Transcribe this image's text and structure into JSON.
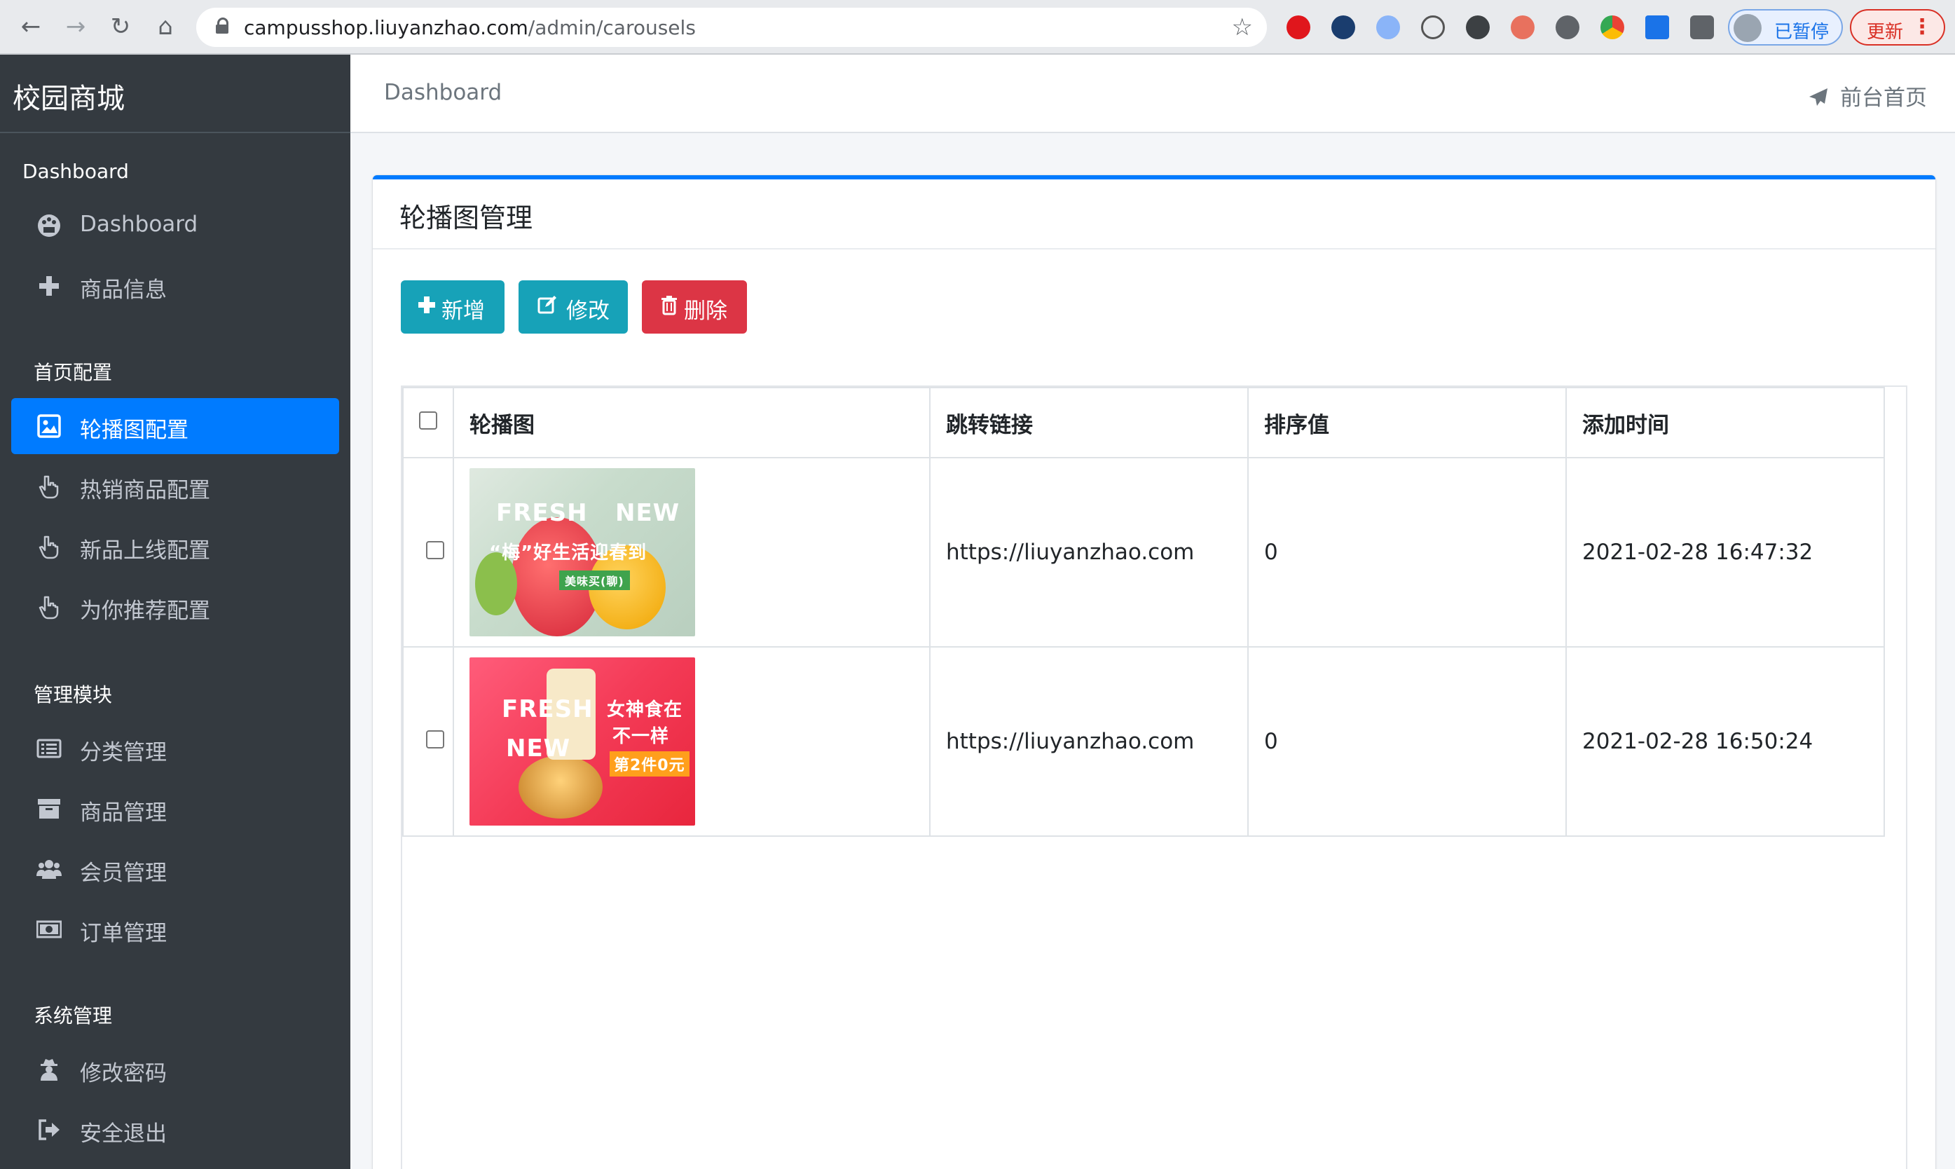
{
  "browser": {
    "url_host": "campusshop.liuyanzhao.com",
    "url_path": "/admin/carousels",
    "profile_label": "已暂停",
    "update_label": "更新"
  },
  "sidebar": {
    "brand": "校园商城",
    "sections": [
      {
        "title": "Dashboard",
        "items": [
          {
            "label": "Dashboard",
            "icon": "palette-icon"
          },
          {
            "label": "商品信息",
            "icon": "plus-icon"
          }
        ]
      },
      {
        "title": "首页配置",
        "items": [
          {
            "label": "轮播图配置",
            "icon": "image-icon",
            "active": true
          },
          {
            "label": "热销商品配置",
            "icon": "hand-pointer-icon"
          },
          {
            "label": "新品上线配置",
            "icon": "hand-pointer-icon"
          },
          {
            "label": "为你推荐配置",
            "icon": "hand-pointer-icon"
          }
        ]
      },
      {
        "title": "管理模块",
        "items": [
          {
            "label": "分类管理",
            "icon": "list-alt-icon"
          },
          {
            "label": "商品管理",
            "icon": "archive-icon"
          },
          {
            "label": "会员管理",
            "icon": "users-icon"
          },
          {
            "label": "订单管理",
            "icon": "money-bill-icon"
          }
        ]
      },
      {
        "title": "系统管理",
        "items": [
          {
            "label": "修改密码",
            "icon": "user-secret-icon"
          },
          {
            "label": "安全退出",
            "icon": "sign-out-icon"
          }
        ]
      }
    ]
  },
  "topbar": {
    "breadcrumb": "Dashboard",
    "home_link": "前台首页"
  },
  "card": {
    "title": "轮播图管理",
    "buttons": {
      "add": "新增",
      "edit": "修改",
      "delete": "删除"
    },
    "table": {
      "columns": [
        "轮播图",
        "跳转链接",
        "排序值",
        "添加时间"
      ],
      "rows": [
        {
          "image_text": {
            "line1_left": "FRESH",
            "line1_right": "NEW",
            "line2": "“梅”好生活迎春到",
            "tag": "美味买(聊)"
          },
          "link": "https://liuyanzhao.com",
          "sort": "0",
          "created": "2021-02-28 16:47:32"
        },
        {
          "image_text": {
            "line1_left": "FRESH",
            "line2_left": "NEW",
            "line1_right": "女神食在",
            "line2_right": "不一样",
            "tag": "第2件0元"
          },
          "link": "https://liuyanzhao.com",
          "sort": "0",
          "created": "2021-02-28 16:50:24"
        }
      ]
    }
  },
  "colors": {
    "sidebar_bg": "#343a40",
    "active": "#007bff",
    "info": "#17a2b8",
    "danger": "#dc3545"
  }
}
